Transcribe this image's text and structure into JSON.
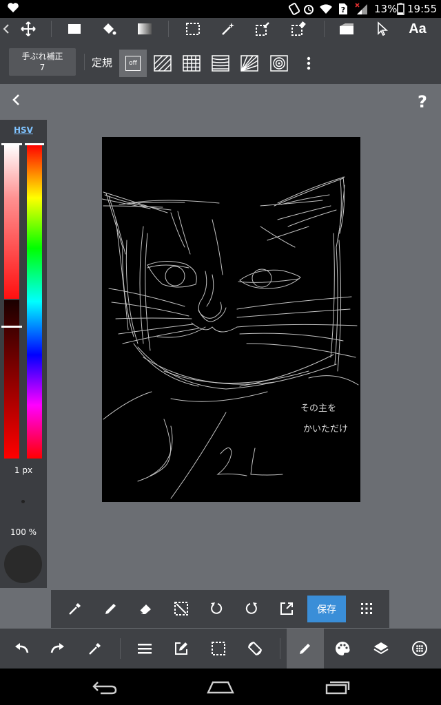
{
  "status_bar": {
    "battery": "13%",
    "time": "19:55"
  },
  "toolbar_top": {
    "icons": [
      "move-icon",
      "fill-rect-icon",
      "bucket-icon",
      "gradient-icon",
      "select-rect-icon",
      "magic-wand-icon",
      "select-pen-icon",
      "select-eraser-icon",
      "fill-frame-icon",
      "select-arrow-icon",
      "text-icon"
    ],
    "text_tool_label": "Aa"
  },
  "toolbar_second": {
    "stabilizer_label": "手ぶれ補正",
    "stabilizer_value": "7",
    "ruler_label": "定規",
    "ruler_off_label": "off",
    "ruler_options": [
      "parallel-ruler",
      "grid-ruler",
      "perspective-ruler",
      "radial-ruler",
      "concentric-ruler"
    ]
  },
  "canvas_area": {
    "help_label": "?"
  },
  "color_panel": {
    "mode_link": "HSV",
    "brush_size": "1 px",
    "opacity": "100 %",
    "current_color": "#2a2a2a",
    "hue": 0,
    "saturation": 1.0,
    "value": 0.18
  },
  "artwork": {
    "background": "#000000",
    "stroke_color": "#d9d9d9",
    "caption_line1": "その主を",
    "caption_line2": "かいただけ",
    "date_text": "2/22"
  },
  "float_bar": {
    "tools": [
      "eyedropper-icon",
      "pen-icon",
      "eraser-icon",
      "clear-selection-icon",
      "rotate-left-icon",
      "rotate-right-icon",
      "export-icon"
    ],
    "save_label": "保存",
    "accent": "#3a8ed8"
  },
  "bottom_bar": {
    "tools": [
      "undo-icon",
      "redo-icon",
      "eyedropper-icon",
      "menu-icon",
      "edit-icon",
      "selection-icon",
      "rotate-canvas-icon",
      "pen-icon",
      "palette-icon",
      "layers-icon",
      "materials-icon"
    ],
    "active_tool": "pen-icon"
  }
}
